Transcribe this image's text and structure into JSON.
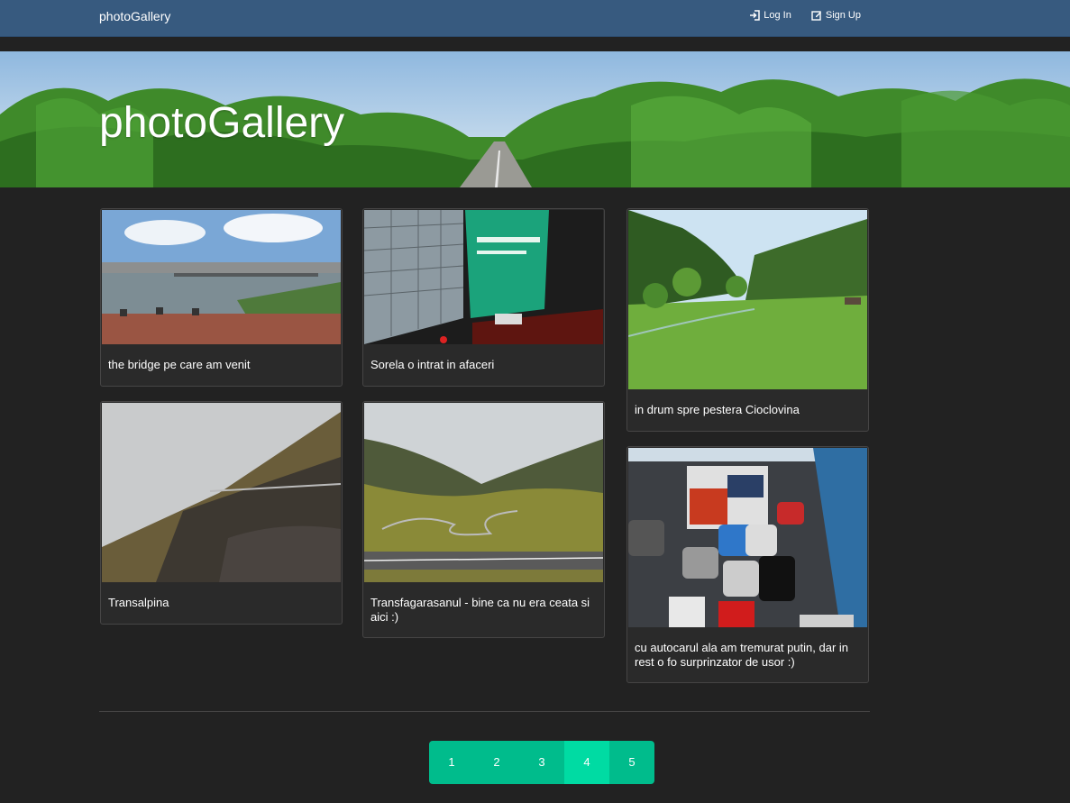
{
  "navbar": {
    "brand": "photoGallery",
    "login_label": "Log In",
    "signup_label": "Sign Up"
  },
  "hero": {
    "title": "photoGallery"
  },
  "gallery": {
    "items": [
      {
        "caption": "the bridge pe care am venit"
      },
      {
        "caption": "Sorela o intrat in afaceri"
      },
      {
        "caption": "in drum spre pestera Cioclovina"
      },
      {
        "caption": "Transalpina"
      },
      {
        "caption": "Transfagarasanul - bine ca nu era ceata si aici :)"
      },
      {
        "caption": "cu autocarul ala am tremurat putin, dar in rest o fo surprinzator de usor :)"
      }
    ]
  },
  "pagination": {
    "pages": [
      "1",
      "2",
      "3",
      "4",
      "5"
    ],
    "current": "4"
  },
  "colors": {
    "navbar": "#375a7f",
    "background": "#222222",
    "accent": "#00bc8c",
    "accent_active": "#00dba3"
  }
}
